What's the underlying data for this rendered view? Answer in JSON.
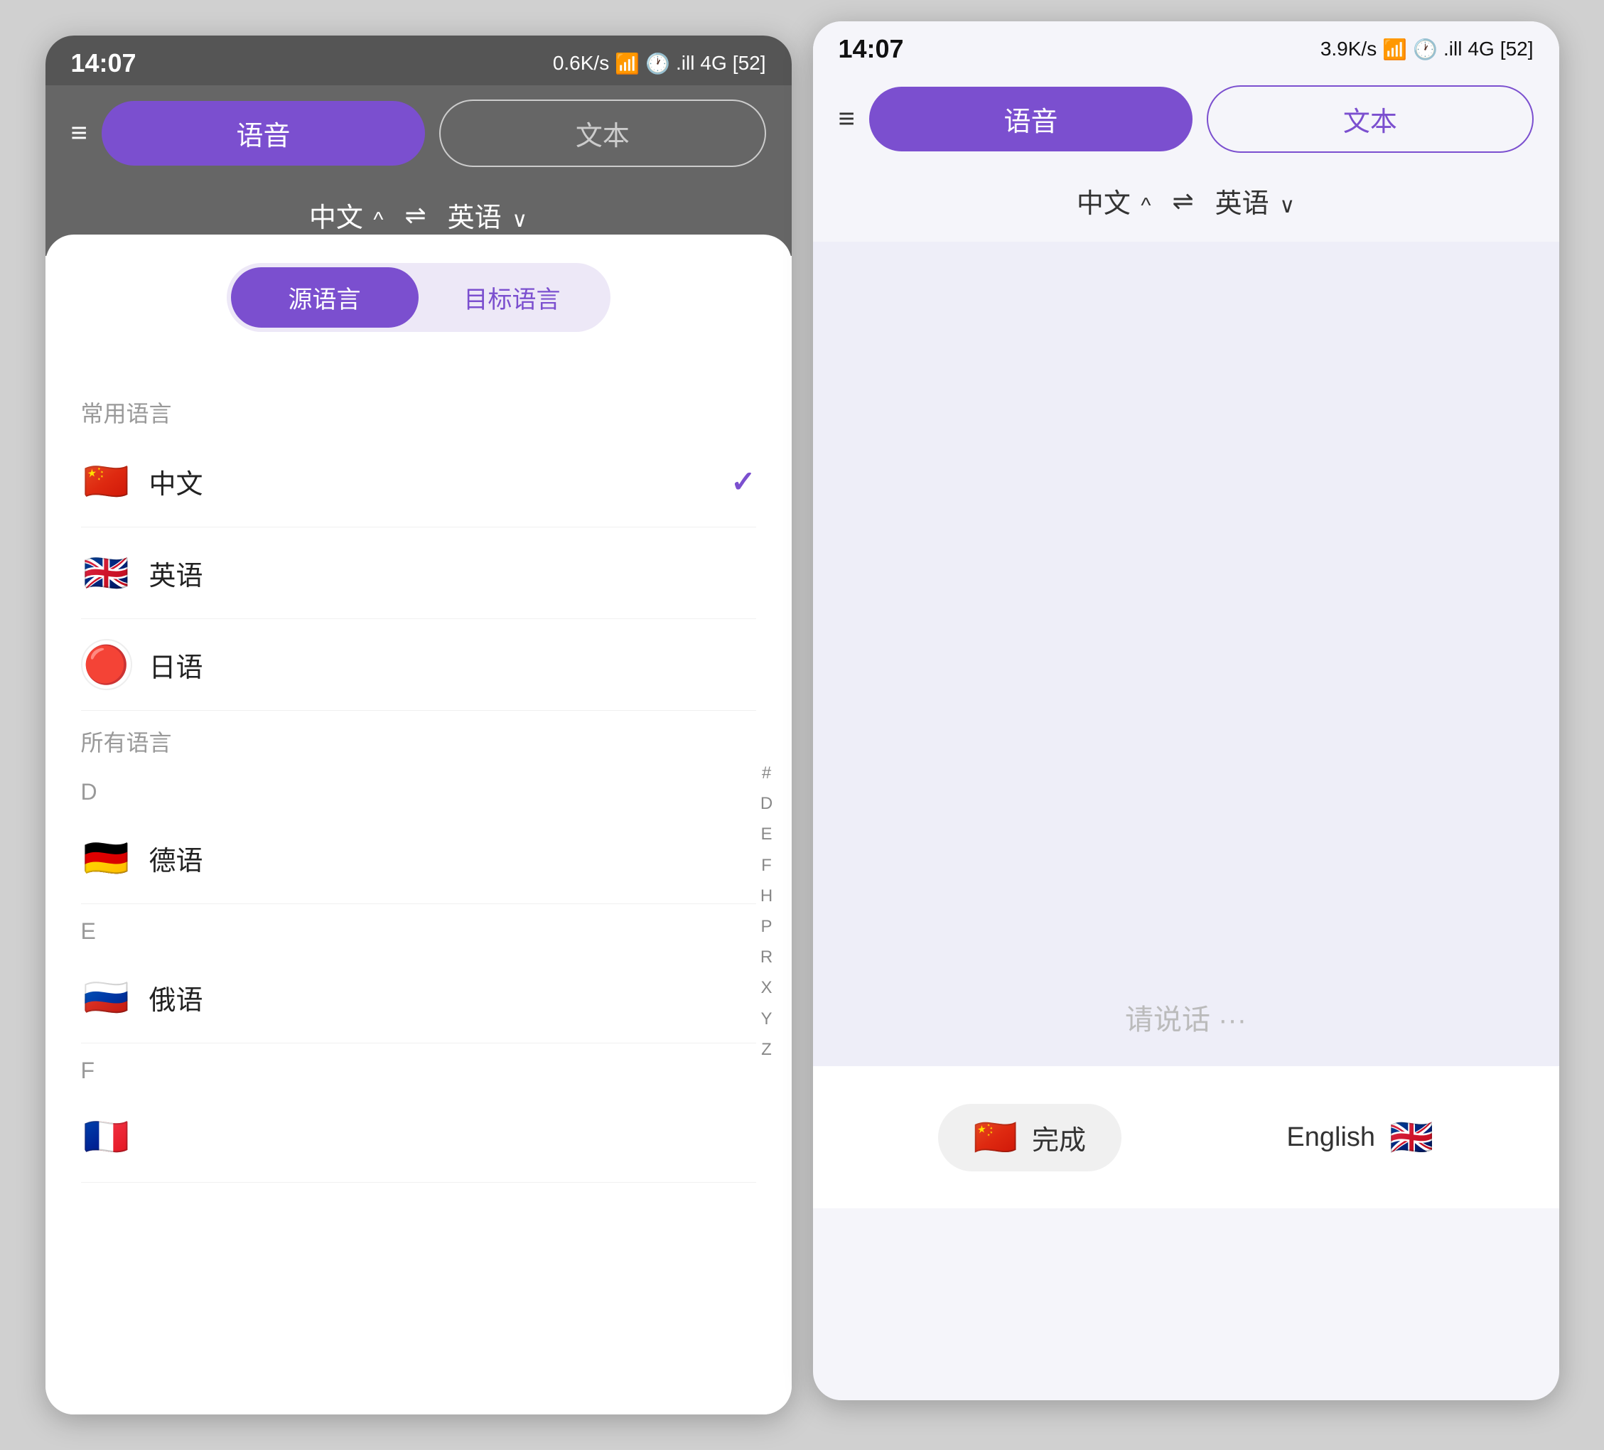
{
  "left_phone": {
    "status_bar": {
      "time": "14:07",
      "network": "0.6K/s",
      "signal": "4G",
      "battery": "52"
    },
    "header": {
      "menu_icon": "≡",
      "tab_voice": "语音",
      "tab_text": "文本",
      "lang_source": "中文",
      "lang_source_arrow": "^",
      "swap": "⇌",
      "lang_target": "英语",
      "lang_target_arrow": "v"
    },
    "sheet": {
      "toggle_source": "源语言",
      "toggle_target": "目标语言",
      "section_common": "常用语言",
      "common_languages": [
        {
          "flag": "🇨🇳",
          "name": "中文",
          "selected": true
        },
        {
          "flag": "🇬🇧",
          "name": "英语",
          "selected": false
        },
        {
          "flag": "🇯🇵",
          "name": "日语",
          "selected": false
        }
      ],
      "section_all": "所有语言",
      "all_languages": [
        {
          "section_letter": "D",
          "items": [
            {
              "flag": "🇩🇪",
              "name": "德语"
            }
          ]
        },
        {
          "section_letter": "E",
          "items": [
            {
              "flag": "🇷🇺",
              "name": "俄语"
            }
          ]
        },
        {
          "section_letter": "F",
          "items": []
        }
      ],
      "alpha_index": [
        "#",
        "D",
        "E",
        "F",
        "H",
        "P",
        "R",
        "X",
        "Y",
        "Z"
      ]
    }
  },
  "right_phone": {
    "status_bar": {
      "time": "14:07",
      "network": "3.9K/s",
      "signal": "4G",
      "battery": "52"
    },
    "header": {
      "menu_icon": "≡",
      "tab_voice": "语音",
      "tab_text": "文本",
      "lang_source": "中文",
      "lang_source_arrow": "^",
      "swap": "⇌",
      "lang_target": "英语",
      "lang_target_arrow": "v"
    },
    "main": {
      "voice_hint": "请说话 ···"
    },
    "bottom": {
      "done_flag": "🇨🇳",
      "done_text": "完成",
      "english_text": "English",
      "english_flag": "🇬🇧"
    }
  }
}
